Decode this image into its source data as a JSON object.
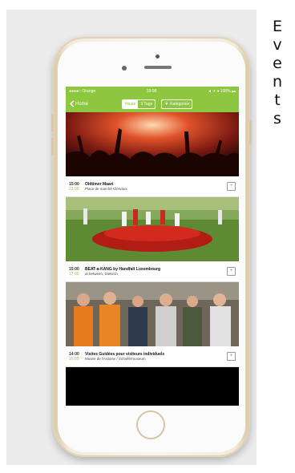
{
  "side_word": "Events",
  "status_bar": {
    "carrier": "●●●●○ Orange",
    "time": "19:08",
    "battery": "◄ ✈ ♦ 100% ▬"
  },
  "nav": {
    "back_label": "Home",
    "segments": [
      "Heute",
      "3 Tage"
    ],
    "filter_label": "Kategorien"
  },
  "colors": {
    "accent": "#8dc63f",
    "phone_gold": "#e6d7bb"
  },
  "events": [
    {
      "start": "15:00",
      "end": "23:00",
      "title": "Oldtimer Maart",
      "place": "Place de marché Clervaux",
      "image": "concert-crowd-image"
    },
    {
      "start": "15:00",
      "end": "17:00",
      "title": "BEAT-a-KANG by Handfalt Luxembourg",
      "place": "at between, Diekirch",
      "image": "outdoor-performance-image"
    },
    {
      "start": "14:00",
      "end": "15:00",
      "title": "Visites Guidées pour visiteurs individuels",
      "place": "Musée de l'Ardoise / Schiefermuseum",
      "image": "tour-group-image"
    }
  ]
}
